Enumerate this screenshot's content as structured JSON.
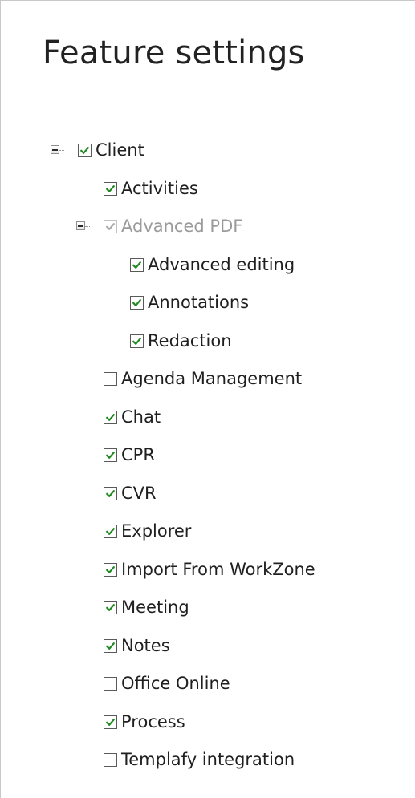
{
  "title": "Feature settings",
  "colors": {
    "check": "#1f8a1f",
    "disabled_text": "#9a9a9a",
    "text": "#1f1f1f"
  },
  "tree": [
    {
      "id": "client",
      "label": "Client",
      "checked": true,
      "disabled": false,
      "expander": "collapse-icon",
      "level": 0
    },
    {
      "id": "activities",
      "label": "Activities",
      "checked": true,
      "disabled": false,
      "level": 1
    },
    {
      "id": "advanced-pdf",
      "label": "Advanced PDF",
      "checked": true,
      "disabled": true,
      "expander": "collapse-icon",
      "level": 1
    },
    {
      "id": "advanced-editing",
      "label": "Advanced editing",
      "checked": true,
      "disabled": false,
      "level": 2
    },
    {
      "id": "annotations",
      "label": "Annotations",
      "checked": true,
      "disabled": false,
      "level": 2
    },
    {
      "id": "redaction",
      "label": "Redaction",
      "checked": true,
      "disabled": false,
      "level": 2
    },
    {
      "id": "agenda-management",
      "label": "Agenda Management",
      "checked": false,
      "disabled": false,
      "level": 1
    },
    {
      "id": "chat",
      "label": "Chat",
      "checked": true,
      "disabled": false,
      "level": 1
    },
    {
      "id": "cpr",
      "label": "CPR",
      "checked": true,
      "disabled": false,
      "level": 1
    },
    {
      "id": "cvr",
      "label": "CVR",
      "checked": true,
      "disabled": false,
      "level": 1
    },
    {
      "id": "explorer",
      "label": "Explorer",
      "checked": true,
      "disabled": false,
      "level": 1
    },
    {
      "id": "import-from-workzone",
      "label": "Import From WorkZone",
      "checked": true,
      "disabled": false,
      "level": 1
    },
    {
      "id": "meeting",
      "label": "Meeting",
      "checked": true,
      "disabled": false,
      "level": 1
    },
    {
      "id": "notes",
      "label": "Notes",
      "checked": true,
      "disabled": false,
      "level": 1
    },
    {
      "id": "office-online",
      "label": "Office Online",
      "checked": false,
      "disabled": false,
      "level": 1
    },
    {
      "id": "process",
      "label": "Process",
      "checked": true,
      "disabled": false,
      "level": 1
    },
    {
      "id": "templafy-integration",
      "label": "Templafy integration",
      "checked": false,
      "disabled": false,
      "level": 1
    }
  ]
}
